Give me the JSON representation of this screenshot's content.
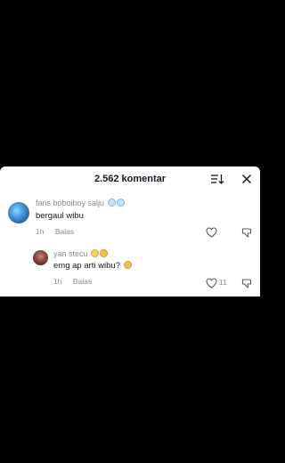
{
  "comments_panel": {
    "title": "2.562 komentar",
    "sort_icon": "sort-icon",
    "close_icon": "close-icon"
  },
  "comments": [
    {
      "username": "fans boboiboy salju",
      "username_emoji": [
        "cold-face-emoji",
        "cold-face-emoji"
      ],
      "text": "bergaul wibu",
      "time": "1h",
      "reply_label": "Balas",
      "likes": ""
    },
    {
      "username": "yan stecu",
      "username_emoji": [
        "sweat-smile-emoji",
        "cat-emoji"
      ],
      "text": "emg ap arti wibu?",
      "text_emoji": "cat-emoji",
      "time": "1h",
      "reply_label": "Balas",
      "likes": "11"
    }
  ],
  "colors": {
    "background": "#000000",
    "sheet": "#ffffff",
    "text_primary": "#161823",
    "text_secondary": "#8a8b91"
  }
}
